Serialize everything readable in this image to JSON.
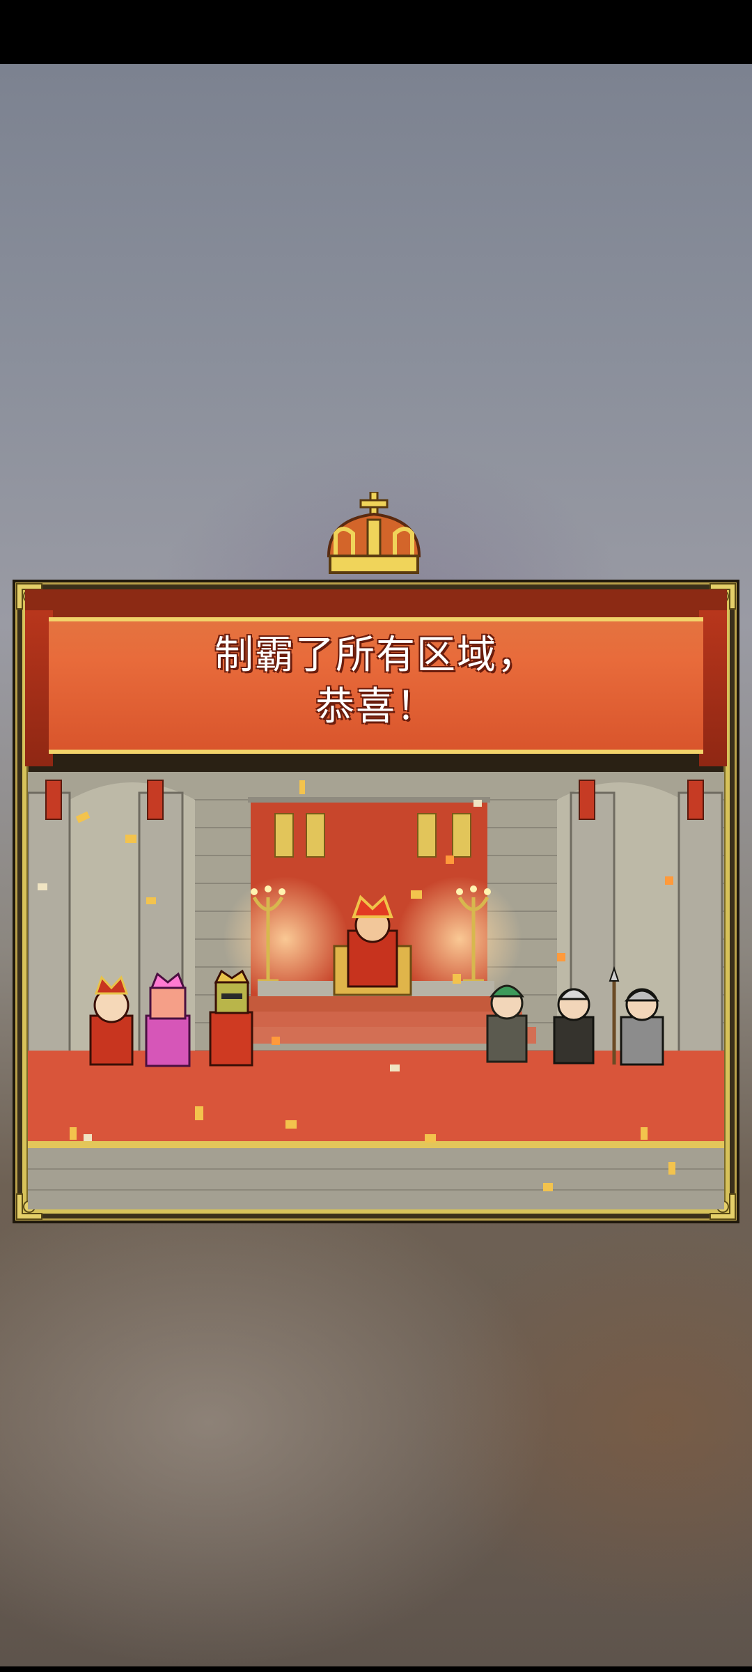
{
  "dialog": {
    "title": "制霸了所有区域，\n恭喜！"
  },
  "colors": {
    "banner_red": "#e86b3b",
    "gold": "#d7c25a",
    "carpet": "#d9553a"
  },
  "icons": {
    "crown": "crown-icon"
  }
}
